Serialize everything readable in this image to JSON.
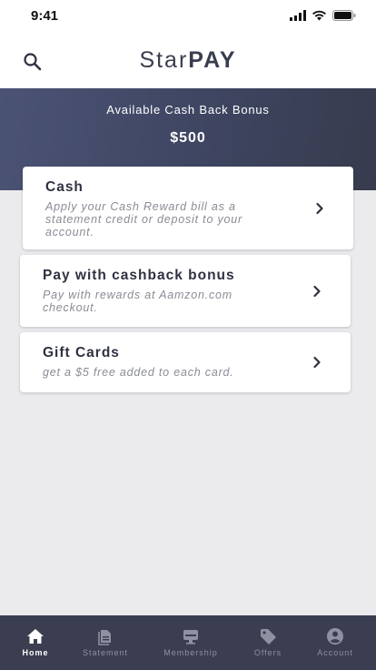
{
  "status_bar": {
    "time": "9:41"
  },
  "header": {
    "brand_part1": "Star",
    "brand_part2": "PAY"
  },
  "hero": {
    "label": "Available Cash Back Bonus",
    "amount": "$500"
  },
  "options": [
    {
      "title": "Cash",
      "description": "Apply your Cash Reward bill as a statement credit or deposit to your account."
    },
    {
      "title": "Pay with cashback bonus",
      "description": "Pay with rewards at Aamzon.com checkout."
    },
    {
      "title": "Gift Cards",
      "description": "get a $5 free added to each card."
    }
  ],
  "tabs": [
    {
      "label": "Home",
      "icon": "home-icon",
      "active": true
    },
    {
      "label": "Statement",
      "icon": "statement-icon",
      "active": false
    },
    {
      "label": "Membership",
      "icon": "membership-icon",
      "active": false
    },
    {
      "label": "Offers",
      "icon": "offers-tag-icon",
      "active": false
    },
    {
      "label": "Account",
      "icon": "account-icon",
      "active": false
    }
  ],
  "colors": {
    "hero_start": "#4b5375",
    "hero_end": "#373b4d",
    "tab_bar": "#3a3e50",
    "background": "#ebebee",
    "text_primary": "#2e3140"
  }
}
